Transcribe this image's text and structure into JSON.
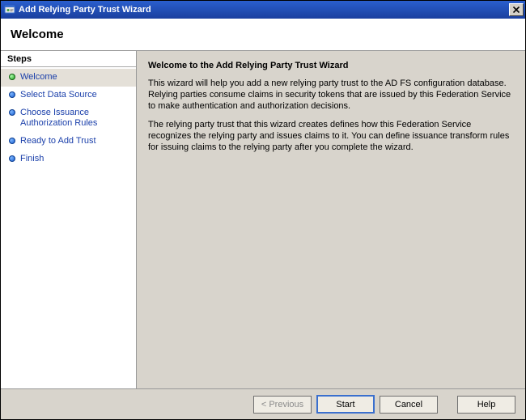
{
  "window": {
    "title": "Add Relying Party Trust Wizard"
  },
  "header": {
    "title": "Welcome"
  },
  "sidebar": {
    "heading": "Steps",
    "items": [
      {
        "label": "Welcome",
        "current": true
      },
      {
        "label": "Select Data Source",
        "current": false
      },
      {
        "label": "Choose Issuance Authorization Rules",
        "current": false
      },
      {
        "label": "Ready to Add Trust",
        "current": false
      },
      {
        "label": "Finish",
        "current": false
      }
    ]
  },
  "content": {
    "title": "Welcome to the Add Relying Party Trust Wizard",
    "p1": "This wizard will help you add a new relying party trust to the AD FS configuration database.  Relying parties consume claims in security tokens that are issued by this Federation Service to make authentication and authorization decisions.",
    "p2": "The relying party trust that this wizard creates defines how this Federation Service recognizes the relying party and issues claims to it. You can define issuance transform rules for issuing claims to the relying party after you complete the wizard."
  },
  "footer": {
    "previous": "< Previous",
    "start": "Start",
    "cancel": "Cancel",
    "help": "Help"
  }
}
